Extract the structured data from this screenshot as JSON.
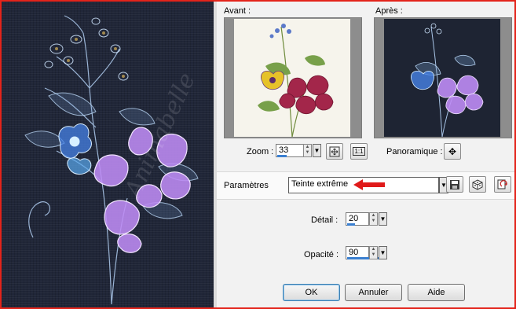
{
  "labels": {
    "before": "Avant :",
    "after": "Après :",
    "zoom": "Zoom :",
    "pan": "Panoramique :",
    "params": "Paramètres",
    "detail": "Détail :",
    "opacity": "Opacité :"
  },
  "zoom": {
    "value": "33",
    "fill_fraction": 0.33
  },
  "params": {
    "preset": "Teinte extrême"
  },
  "detail": {
    "value": "20",
    "fill_fraction": 0.2
  },
  "opacity": {
    "value": "90",
    "fill_fraction": 0.9
  },
  "buttons": {
    "ok": "OK",
    "cancel": "Annuler",
    "help": "Aide",
    "actual_size": "1:1"
  },
  "watermark": "Animabelle",
  "colors": {
    "frame": "#e3241b",
    "arrow": "#e01a1a",
    "accent": "#3a7fd0"
  },
  "icons": [
    "fit-window-icon",
    "actual-size-icon",
    "pan-icon",
    "save-preset-icon",
    "random-dice-icon",
    "reset-icon",
    "red-arrow-icon"
  ]
}
